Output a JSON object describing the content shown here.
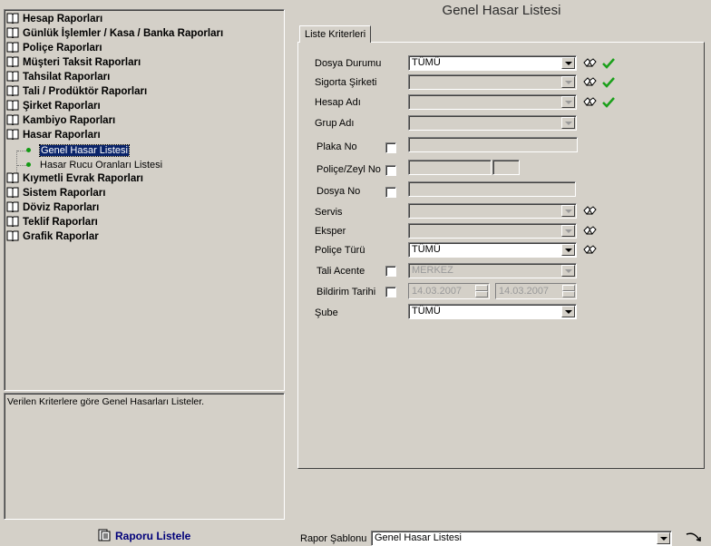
{
  "tree": {
    "items": [
      {
        "label": "Hesap Raporları"
      },
      {
        "label": "Günlük İşlemler / Kasa / Banka Raporları"
      },
      {
        "label": "Poliçe Raporları"
      },
      {
        "label": "Müşteri Taksit Raporları"
      },
      {
        "label": "Tahsilat Raporları"
      },
      {
        "label": "Tali / Prodüktör Raporları"
      },
      {
        "label": "Şirket Raporları"
      },
      {
        "label": "Kambiyo Raporları"
      },
      {
        "label": "Hasar Raporları"
      },
      {
        "label": "Kıymetli Evrak Raporları"
      },
      {
        "label": "Sistem Raporları"
      },
      {
        "label": "Döviz Raporları"
      },
      {
        "label": "Teklif Raporları"
      },
      {
        "label": "Grafik Raporlar"
      }
    ],
    "hasar_children": [
      {
        "label": "Genel Hasar Listesi",
        "selected": true
      },
      {
        "label": "Hasar Rucu Oranları Listesi",
        "selected": false
      }
    ]
  },
  "description": "Verilen Kriterlere göre Genel Hasarları Listeler.",
  "list_button_label": "Raporu Listele",
  "page_title": "Genel Hasar Listesi",
  "tab_label": "Liste Kriterleri",
  "form": {
    "dosya_durumu": {
      "label": "Dosya Durumu",
      "value": "TÜMÜ"
    },
    "sigorta_sirketi": {
      "label": "Sigorta Şirketi",
      "value": ""
    },
    "hesap_adi": {
      "label": "Hesap Adı",
      "value": ""
    },
    "grup_adi": {
      "label": "Grup Adı",
      "value": ""
    },
    "plaka_no": {
      "label": "Plaka No"
    },
    "police_zeyl_no": {
      "label": "Poliçe/Zeyl No"
    },
    "dosya_no": {
      "label": "Dosya No"
    },
    "servis": {
      "label": "Servis",
      "value": ""
    },
    "eksper": {
      "label": "Eksper",
      "value": ""
    },
    "police_turu": {
      "label": "Poliçe Türü",
      "value": "TÜMÜ"
    },
    "tali_acente": {
      "label": "Tali Acente",
      "value": "MERKEZ"
    },
    "bildirim_tarihi": {
      "label": "Bildirim Tarihi",
      "start": "14.03.2007",
      "end": "14.03.2007"
    },
    "sube": {
      "label": "Şube",
      "value": "TÜMÜ"
    }
  },
  "template": {
    "label": "Rapor Şablonu",
    "value": "Genel Hasar Listesi"
  },
  "colors": {
    "selection": "#0a246a",
    "check": "#1aa01a",
    "link": "#00007a",
    "bullet": "#129a12"
  },
  "icons": {
    "lookup": "glasses-icon",
    "select": "checkmark-icon",
    "tree": "book-icon",
    "report": "report-icon",
    "exit": "exit-arrow-icon"
  }
}
